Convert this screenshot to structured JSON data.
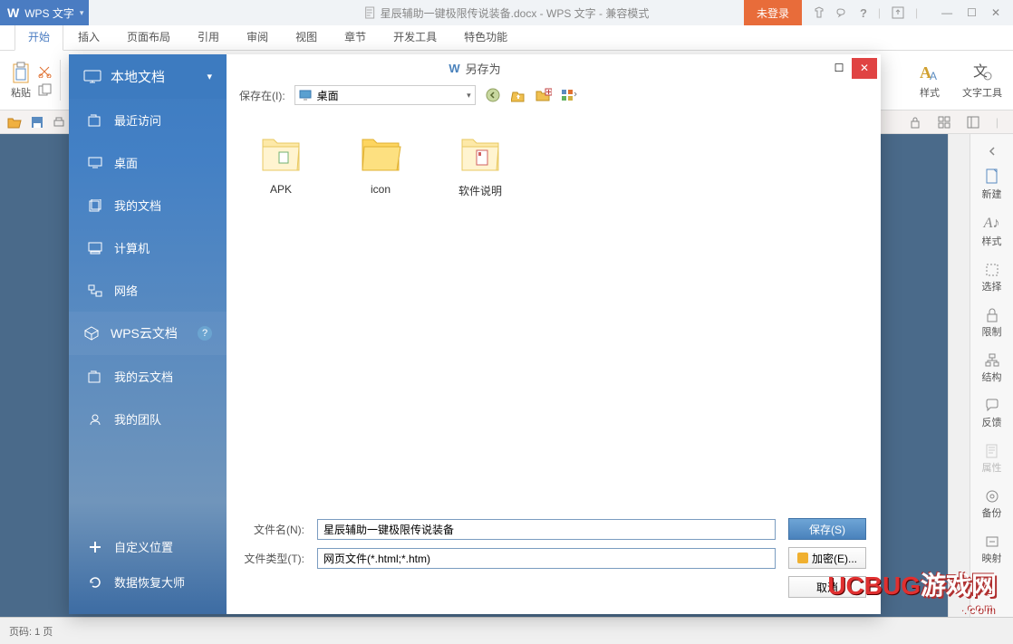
{
  "title_bar": {
    "app_name": "WPS 文字",
    "doc_title": "星辰辅助一键极限传说装备.docx - WPS 文字 - 兼容模式",
    "login_label": "未登录"
  },
  "ribbon_tabs": [
    "开始",
    "插入",
    "页面布局",
    "引用",
    "审阅",
    "视图",
    "章节",
    "开发工具",
    "特色功能"
  ],
  "ribbon": {
    "paste_label": "粘贴",
    "style_label": "样式",
    "txt_tools_label": "文字工具"
  },
  "dialog": {
    "title": "另存为",
    "save_in_label": "保存在(I):",
    "location": "桌面",
    "sidebar_header": "本地文档",
    "sidebar_items": [
      "最近访问",
      "桌面",
      "我的文档",
      "计算机",
      "网络"
    ],
    "sidebar_cloud_header": "WPS云文档",
    "sidebar_cloud_items": [
      "我的云文档",
      "我的团队"
    ],
    "sidebar_bottom": [
      "自定义位置",
      "数据恢复大师"
    ],
    "files": [
      "APK",
      "icon",
      "软件说明"
    ],
    "filename_label": "文件名(N):",
    "filename_value": "星辰辅助一键极限传说装备",
    "filetype_label": "文件类型(T):",
    "filetype_value": "网页文件(*.html;*.htm)",
    "save_btn": "保存(S)",
    "encrypt_btn": "加密(E)...",
    "cancel_btn": "取消"
  },
  "right_tools": [
    "新建",
    "样式",
    "选择",
    "限制",
    "结构",
    "反馈",
    "属性",
    "备份",
    "映射"
  ],
  "status_bar": {
    "page_info": "页码: 1  页"
  },
  "watermark": {
    "brand": "UCBUG",
    "suffix": "游戏网",
    "domain": ".com"
  }
}
